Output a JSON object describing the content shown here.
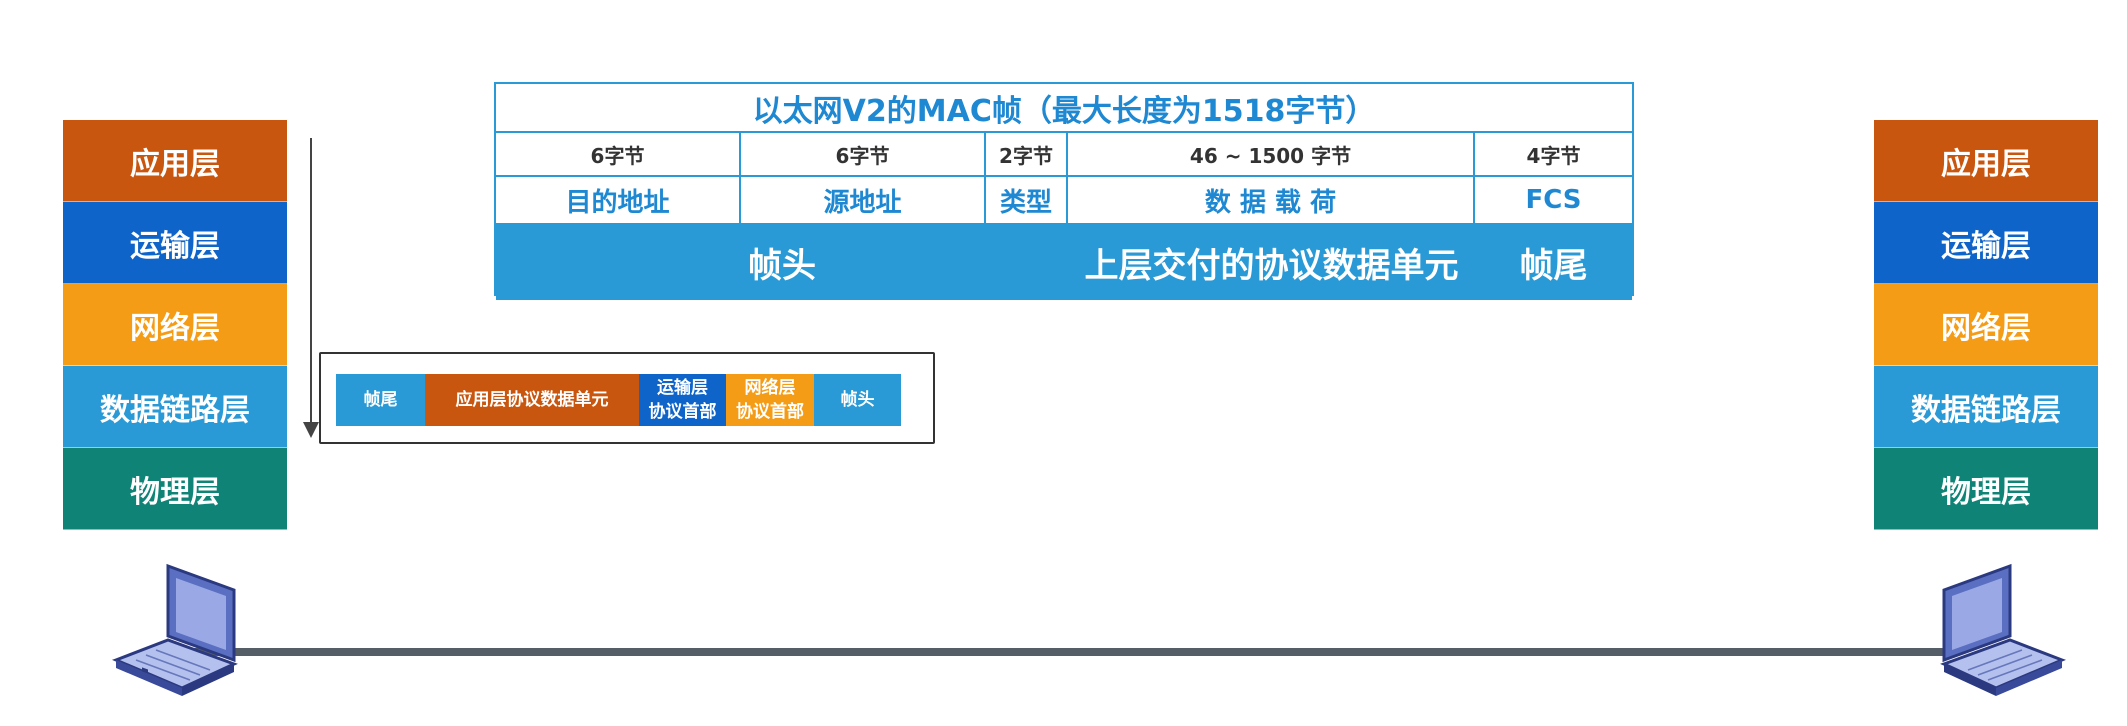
{
  "left_stack": {
    "layers": [
      "应用层",
      "运输层",
      "网络层",
      "数据链路层",
      "物理层"
    ]
  },
  "right_stack": {
    "layers": [
      "应用层",
      "运输层",
      "网络层",
      "数据链路层",
      "物理层"
    ]
  },
  "mac_frame": {
    "title": "以太网V2的MAC帧（最大长度为1518字节）",
    "sizes": [
      "6字节",
      "6字节",
      "2字节",
      "46 ~ 1500 字节",
      "4字节"
    ],
    "fields": [
      "目的地址",
      "源地址",
      "类型",
      "数 据 载 荷",
      "FCS"
    ],
    "bar": {
      "head": "帧头",
      "pdu": "上层交付的协议数据单元",
      "tail": "帧尾"
    }
  },
  "encapsulated_frame": {
    "tail": "帧尾",
    "app_pdu": "应用层协议数据单元",
    "transport_header": [
      "运输层",
      "协议首部"
    ],
    "network_header": [
      "网络层",
      "协议首部"
    ],
    "head": "帧头"
  },
  "colors": {
    "application": "#c9560f",
    "transport": "#0e64c8",
    "network": "#f59c16",
    "datalink": "#2a9ad6",
    "physical": "#0e8376"
  },
  "icons": [
    "laptop-icon",
    "down-arrow-icon"
  ]
}
